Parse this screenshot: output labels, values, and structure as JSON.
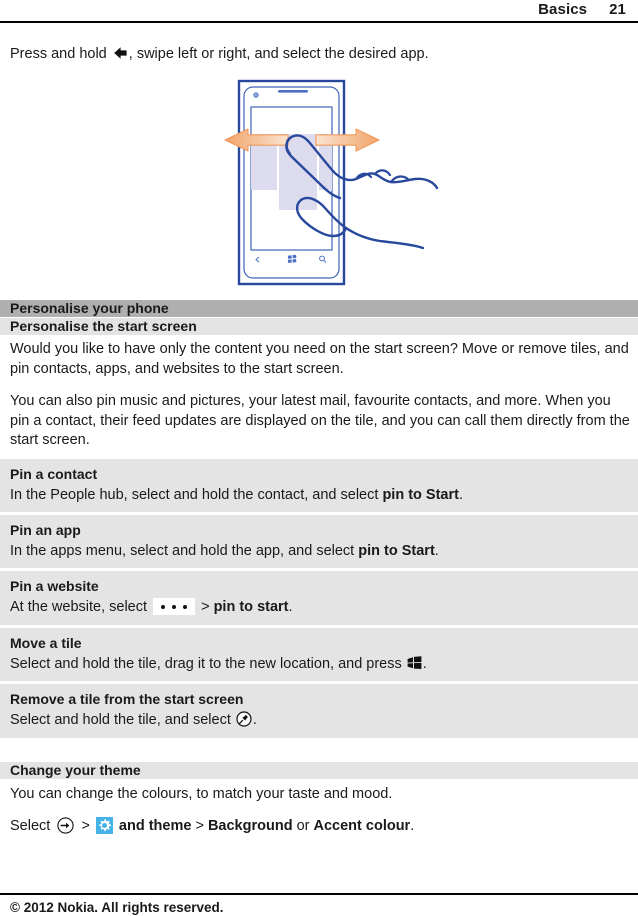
{
  "header": {
    "section": "Basics",
    "page_number": "21"
  },
  "intro": {
    "before_icon": "Press and hold",
    "back_icon": "back-arrow-icon",
    "after_icon": ", swipe left or right, and select the desired app."
  },
  "illustration": {
    "name": "phone-swipe-gesture-illustration",
    "description": "Windows Phone with two fingers swiping left and right across start screen tiles",
    "colors": {
      "outline": "#1f4fa0",
      "tile": "#dcdcee",
      "arrow": "#f4b183"
    }
  },
  "bands": {
    "major": "Personalise your phone",
    "minor": "Personalise the start screen"
  },
  "paragraphs": [
    "Would you like to have only the content you need on the start screen? Move or remove tiles, and pin contacts, apps, and websites to the start screen.",
    "You can also pin music and pictures, your latest mail, favourite contacts, and more. When you pin a contact, their feed updates are displayed on the tile, and you can call them directly from the start screen."
  ],
  "sections": [
    {
      "title": "Pin a contact",
      "body_parts": [
        {
          "type": "text",
          "value": "In the People hub, select and hold the contact, and select "
        },
        {
          "type": "bold",
          "value": "pin to Start"
        },
        {
          "type": "text",
          "value": "."
        }
      ]
    },
    {
      "title": "Pin an app",
      "body_parts": [
        {
          "type": "text",
          "value": "In the apps menu, select and hold the app, and select "
        },
        {
          "type": "bold",
          "value": "pin to Start"
        },
        {
          "type": "text",
          "value": "."
        }
      ]
    },
    {
      "title": "Pin a website",
      "body_parts": [
        {
          "type": "text",
          "value": "At the website, select "
        },
        {
          "type": "icon",
          "value": "more-dots-icon"
        },
        {
          "type": "text",
          "value": " > "
        },
        {
          "type": "bold",
          "value": "pin to start"
        },
        {
          "type": "text",
          "value": "."
        }
      ]
    },
    {
      "title": "Move a tile",
      "body_parts": [
        {
          "type": "text",
          "value": "Select and hold the tile, drag it to the new location, and press "
        },
        {
          "type": "icon",
          "value": "windows-start-icon"
        },
        {
          "type": "text",
          "value": "."
        }
      ]
    },
    {
      "title": "Remove a tile from the start screen",
      "body_parts": [
        {
          "type": "text",
          "value": "Select and hold the tile, and select "
        },
        {
          "type": "icon",
          "value": "unpin-icon"
        },
        {
          "type": "text",
          "value": "."
        }
      ]
    }
  ],
  "theme": {
    "band": "Change your theme",
    "paragraph": "You can change the colours, to match your taste and mood.",
    "select_label": "Select",
    "arrow_icon": "arrow-right-circle-icon",
    "separator1": ">",
    "gear_icon": "settings-gear-icon",
    "and_theme": "and theme",
    "separator2": ">",
    "option1": "Background",
    "or": "or",
    "option2": "Accent colour",
    "period": ".",
    "gear_color": "#45b2e8"
  },
  "footer": {
    "copyright": "© 2012 Nokia. All rights reserved."
  }
}
